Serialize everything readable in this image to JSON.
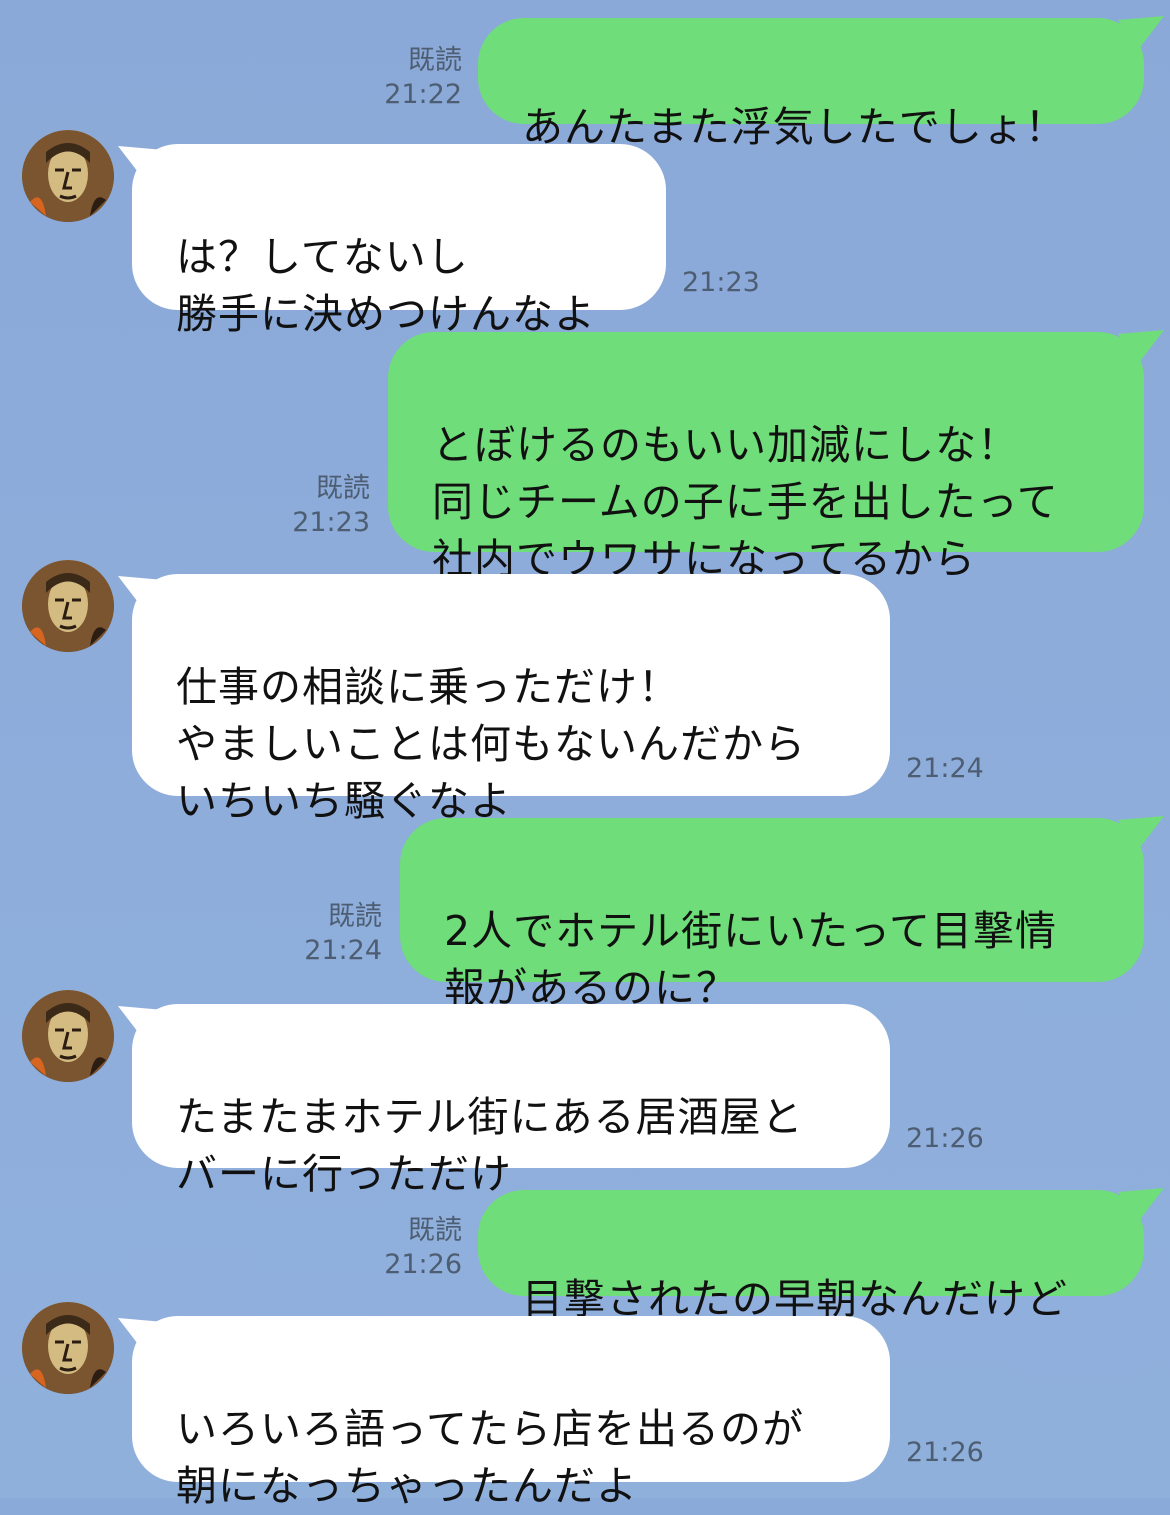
{
  "messages": [
    {
      "side": "out",
      "read_label": "既読",
      "time": "21:22",
      "text": "あんたまた浮気したでしょ！"
    },
    {
      "side": "in",
      "time": "21:23",
      "text": "は？してないし\n勝手に決めつけんなよ"
    },
    {
      "side": "out",
      "read_label": "既読",
      "time": "21:23",
      "text": "とぼけるのもいい加減にしな！\n同じチームの子に手を出したって\n社内でウワサになってるから"
    },
    {
      "side": "in",
      "time": "21:24",
      "text": "仕事の相談に乗っただけ！\nやましいことは何もないんだから\nいちいち騒ぐなよ"
    },
    {
      "side": "out",
      "read_label": "既読",
      "time": "21:24",
      "text": "2人でホテル街にいたって目撃情\n報があるのに？"
    },
    {
      "side": "in",
      "time": "21:26",
      "text": "たまたまホテル街にある居酒屋と\nバーに行っただけ"
    },
    {
      "side": "out",
      "read_label": "既読",
      "time": "21:26",
      "text": "目撃されたの早朝なんだけど"
    },
    {
      "side": "in",
      "time": "21:26",
      "text": "いろいろ語ってたら店を出るのが\n朝になっちゃったんだよ"
    }
  ],
  "colors": {
    "background": "#8aabd9",
    "sent_bubble": "#6fdd79",
    "received_bubble": "#ffffff",
    "meta_text": "#4d5d72"
  }
}
